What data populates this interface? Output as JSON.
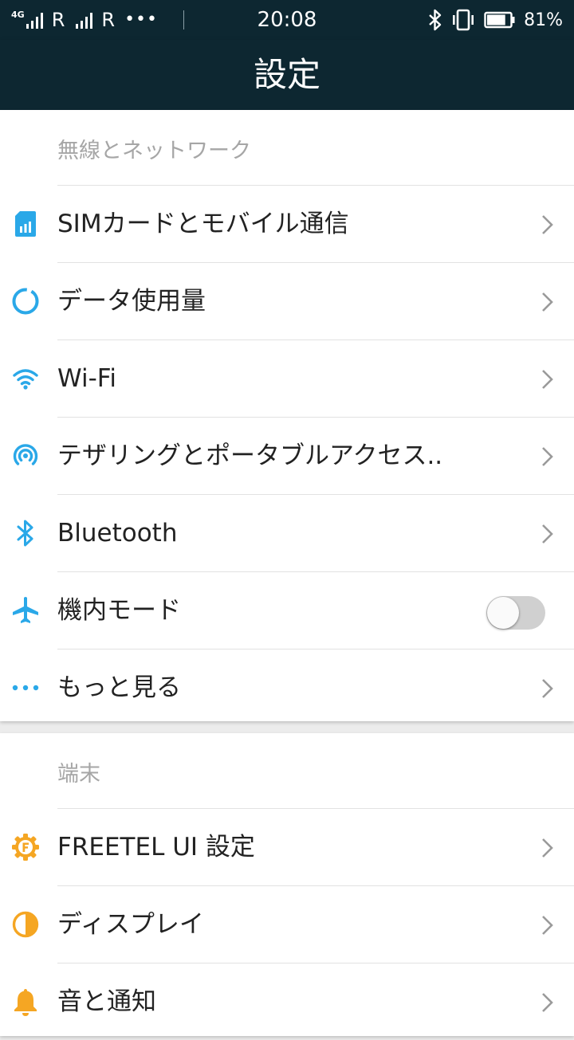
{
  "status_bar": {
    "network_type": "4G",
    "roaming_1": "R",
    "roaming_2": "R",
    "more_dots": "•••",
    "time": "20:08",
    "battery_percent": "81%",
    "battery_level": 0.81
  },
  "app_bar": {
    "title": "設定"
  },
  "sections": {
    "wireless": {
      "header": "無線とネットワーク",
      "items": {
        "sim": "SIMカードとモバイル通信",
        "data_usage": "データ使用量",
        "wifi": "Wi-Fi",
        "tethering": "テザリングとポータブルアクセス..",
        "bluetooth": "Bluetooth",
        "airplane": "機内モード",
        "more": "もっと見る"
      },
      "airplane_mode_on": false
    },
    "device": {
      "header": "端末",
      "items": {
        "freetel_ui": "FREETEL UI 設定",
        "display": "ディスプレイ",
        "sound": "音と通知"
      }
    }
  },
  "colors": {
    "bar_background": "#0d2731",
    "network_icon_accent": "#2aa8e8",
    "device_icon_accent": "#f5a623",
    "section_header_text": "#a6a6a6"
  },
  "icons": {
    "sim": "sim-card-icon",
    "data_usage": "data-usage-icon",
    "wifi": "wifi-icon",
    "tethering": "hotspot-icon",
    "bluetooth": "bluetooth-icon",
    "airplane": "airplane-icon",
    "more": "more-dots-icon",
    "freetel_ui": "gear-f-icon",
    "display": "display-brightness-icon",
    "sound": "bell-icon"
  }
}
